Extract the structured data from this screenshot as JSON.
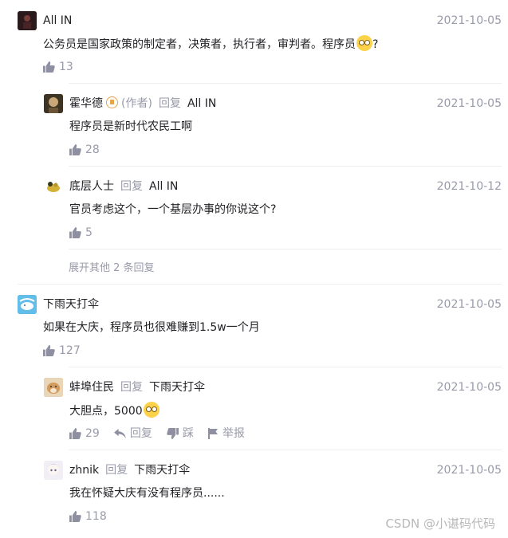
{
  "comments": [
    {
      "user": "All IN",
      "date": "2021-10-05",
      "text": "公务员是国家政策的制定者，决策者，执行者，审判者。程序员",
      "text_suffix": "?",
      "likes": "13",
      "replies": [
        {
          "user": "霍华德",
          "author_tag": "(作者)",
          "reply_label": "回复",
          "reply_to": "All IN",
          "date": "2021-10-05",
          "text": "程序员是新时代农民工啊",
          "likes": "28"
        },
        {
          "user": "底层人士",
          "reply_label": "回复",
          "reply_to": "All IN",
          "date": "2021-10-12",
          "text": "官员考虑这个，一个基层办事的你说这个?",
          "likes": "5"
        }
      ],
      "expand_label": "展开其他 2 条回复"
    },
    {
      "user": "下雨天打伞",
      "date": "2021-10-05",
      "text": "如果在大庆，程序员也很难赚到1.5w一个月",
      "likes": "127",
      "replies": [
        {
          "user": "蚌埠住民",
          "reply_label": "回复",
          "reply_to": "下雨天打伞",
          "date": "2021-10-05",
          "text": "大胆点，5000",
          "likes": "29",
          "actions": {
            "reply": "回复",
            "dislike": "踩",
            "report": "举报"
          }
        },
        {
          "user": "zhnik",
          "reply_label": "回复",
          "reply_to": "下雨天打伞",
          "date": "2021-10-05",
          "text": "我在怀疑大庆有没有程序员......",
          "likes": "118"
        }
      ]
    }
  ],
  "watermark": "CSDN @小谌码代码",
  "colors": {
    "text": "#222226",
    "muted": "#999aaa",
    "divider": "#eeeeee"
  },
  "icons": [
    "thumbs-up-icon",
    "reply-arrow-icon",
    "thumbs-down-icon",
    "flag-icon",
    "author-badge-icon",
    "emoji-icon"
  ]
}
